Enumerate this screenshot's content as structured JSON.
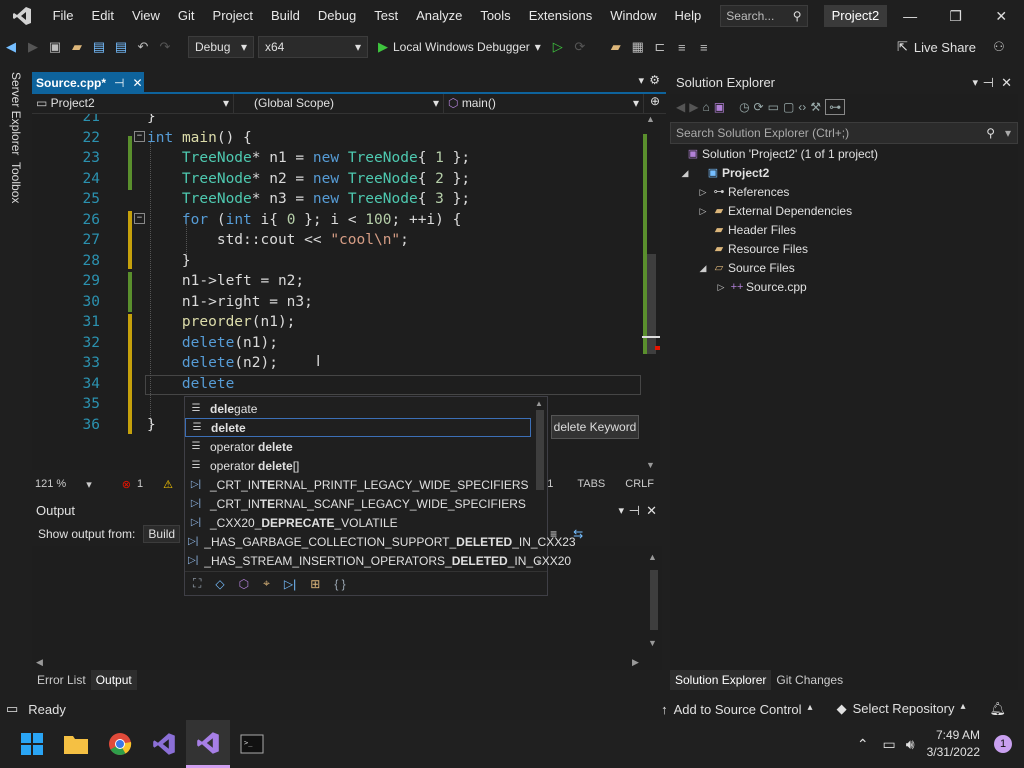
{
  "menubar": {
    "items": [
      "File",
      "Edit",
      "View",
      "Git",
      "Project",
      "Build",
      "Debug",
      "Test",
      "Analyze",
      "Tools",
      "Extensions",
      "Window",
      "Help"
    ],
    "search_placeholder": "Search...",
    "project_name": "Project2",
    "window_buttons": [
      "—",
      "❐",
      "✕"
    ]
  },
  "toolbar": {
    "config": "Debug",
    "platform": "x64",
    "run_label": "Local Windows Debugger",
    "live_share": "Live Share"
  },
  "side": {
    "server_explorer": "Server Explorer",
    "toolbox": "Toolbox"
  },
  "editor": {
    "tab_label": "Source.cpp*",
    "nav_project": "Project2",
    "nav_scope": "(Global Scope)",
    "nav_member": "main()",
    "zoom": "121 %",
    "errors": "1",
    "ln": "11",
    "tabs": "TABS",
    "eol": "CRLF",
    "lines": [
      {
        "n": "21",
        "t": [
          [
            "pl",
            "}"
          ]
        ]
      },
      {
        "n": "22",
        "t": [
          [
            "kw",
            "int"
          ],
          [
            "pl",
            " "
          ],
          [
            "fn",
            "main"
          ],
          [
            "pl",
            "() {"
          ]
        ]
      },
      {
        "n": "23",
        "t": [
          [
            "pl",
            "    "
          ],
          [
            "ty",
            "TreeNode"
          ],
          [
            "pl",
            "* "
          ],
          [
            "id",
            "n1"
          ],
          [
            "pl",
            " = "
          ],
          [
            "kw",
            "new"
          ],
          [
            "pl",
            " "
          ],
          [
            "ty",
            "TreeNode"
          ],
          [
            "pl",
            "{ "
          ],
          [
            "nm",
            "1"
          ],
          [
            "pl",
            " };"
          ]
        ]
      },
      {
        "n": "24",
        "t": [
          [
            "pl",
            "    "
          ],
          [
            "ty",
            "TreeNode"
          ],
          [
            "pl",
            "* "
          ],
          [
            "id",
            "n2"
          ],
          [
            "pl",
            " = "
          ],
          [
            "kw",
            "new"
          ],
          [
            "pl",
            " "
          ],
          [
            "ty",
            "TreeNode"
          ],
          [
            "pl",
            "{ "
          ],
          [
            "nm",
            "2"
          ],
          [
            "pl",
            " };"
          ]
        ]
      },
      {
        "n": "25",
        "t": [
          [
            "pl",
            "    "
          ],
          [
            "ty",
            "TreeNode"
          ],
          [
            "pl",
            "* "
          ],
          [
            "id",
            "n3"
          ],
          [
            "pl",
            " = "
          ],
          [
            "kw",
            "new"
          ],
          [
            "pl",
            " "
          ],
          [
            "ty",
            "TreeNode"
          ],
          [
            "pl",
            "{ "
          ],
          [
            "nm",
            "3"
          ],
          [
            "pl",
            " };"
          ]
        ]
      },
      {
        "n": "26",
        "t": [
          [
            "pl",
            "    "
          ],
          [
            "kw",
            "for"
          ],
          [
            "pl",
            " ("
          ],
          [
            "kw",
            "int"
          ],
          [
            "pl",
            " i{ "
          ],
          [
            "nm",
            "0"
          ],
          [
            "pl",
            " }; i < "
          ],
          [
            "nm",
            "100"
          ],
          [
            "pl",
            "; ++i) {"
          ]
        ]
      },
      {
        "n": "27",
        "t": [
          [
            "pl",
            "        std::cout << "
          ],
          [
            "st",
            "\"cool\\n\""
          ],
          [
            "pl",
            ";"
          ]
        ]
      },
      {
        "n": "28",
        "t": [
          [
            "pl",
            "    }"
          ]
        ]
      },
      {
        "n": "29",
        "t": [
          [
            "pl",
            "    n1->left = n2;"
          ]
        ]
      },
      {
        "n": "30",
        "t": [
          [
            "pl",
            "    n1->right = n3;"
          ]
        ]
      },
      {
        "n": "31",
        "t": [
          [
            "pl",
            "    "
          ],
          [
            "fn",
            "preorder"
          ],
          [
            "pl",
            "(n1);"
          ]
        ]
      },
      {
        "n": "32",
        "t": [
          [
            "pl",
            "    "
          ],
          [
            "kw",
            "delete"
          ],
          [
            "pl",
            "(n1);"
          ]
        ]
      },
      {
        "n": "33",
        "t": [
          [
            "pl",
            "    "
          ],
          [
            "kw",
            "delete"
          ],
          [
            "pl",
            "(n2);"
          ]
        ]
      },
      {
        "n": "34",
        "t": [
          [
            "pl",
            "    "
          ],
          [
            "kw",
            "delete"
          ]
        ]
      },
      {
        "n": "35",
        "t": [
          [
            "pl",
            ""
          ]
        ]
      },
      {
        "n": "36",
        "t": [
          [
            "pl",
            "}"
          ]
        ]
      }
    ]
  },
  "autocomplete": {
    "items": [
      {
        "pre": "",
        "bold": "dele",
        "post": "gate",
        "icon": "keyword"
      },
      {
        "pre": "",
        "bold": "delete",
        "post": "",
        "icon": "keyword"
      },
      {
        "pre": "operator ",
        "bold": "delete",
        "post": "",
        "icon": "keyword"
      },
      {
        "pre": "operator ",
        "bold": "delete",
        "post": "[]",
        "icon": "keyword"
      },
      {
        "pre": "_CRT_IN",
        "bold": "TE",
        "post": "RNAL_PRINTF_LEGACY_WIDE_SPECIFIERS",
        "icon": "macro"
      },
      {
        "pre": "_CRT_IN",
        "bold": "TE",
        "post": "RNAL_SCANF_LEGACY_WIDE_SPECIFIERS",
        "icon": "macro"
      },
      {
        "pre": "_CXX20_",
        "bold": "DEPRECATE",
        "post": "_VOLATILE",
        "icon": "macro"
      },
      {
        "pre": "_HAS_GARBAGE_COLLECTION_SUPPORT_",
        "bold": "DELETED",
        "post": "_IN_CXX23",
        "icon": "macro"
      },
      {
        "pre": "_HAS_STREAM_INSERTION_OPERATORS_",
        "bold": "DELETED",
        "post": "_IN_CXX20",
        "icon": "macro"
      }
    ],
    "tooltip": "delete Keyword",
    "footer_icons": [
      "⛶",
      "◇",
      "⬡",
      "⌖",
      "▷|",
      "⊞",
      "{ }"
    ]
  },
  "output": {
    "title": "Output",
    "show_from_label": "Show output from:",
    "source": "Build"
  },
  "bottom_tabs": [
    "Error List",
    "Output"
  ],
  "solution_explorer": {
    "title": "Solution Explorer",
    "search_placeholder": "Search Solution Explorer (Ctrl+;)",
    "solution": "Solution 'Project2' (1 of 1 project)",
    "project": "Project2",
    "nodes": [
      "References",
      "External Dependencies",
      "Header Files",
      "Resource Files",
      "Source Files",
      "Source.cpp"
    ],
    "tabs": [
      "Solution Explorer",
      "Git Changes"
    ]
  },
  "status": {
    "ready": "Ready",
    "add_source": "Add to Source Control",
    "select_repo": "Select Repository",
    "notif_count": "1"
  },
  "taskbar": {
    "time": "7:49 AM",
    "date": "3/31/2022",
    "badge": "1"
  }
}
